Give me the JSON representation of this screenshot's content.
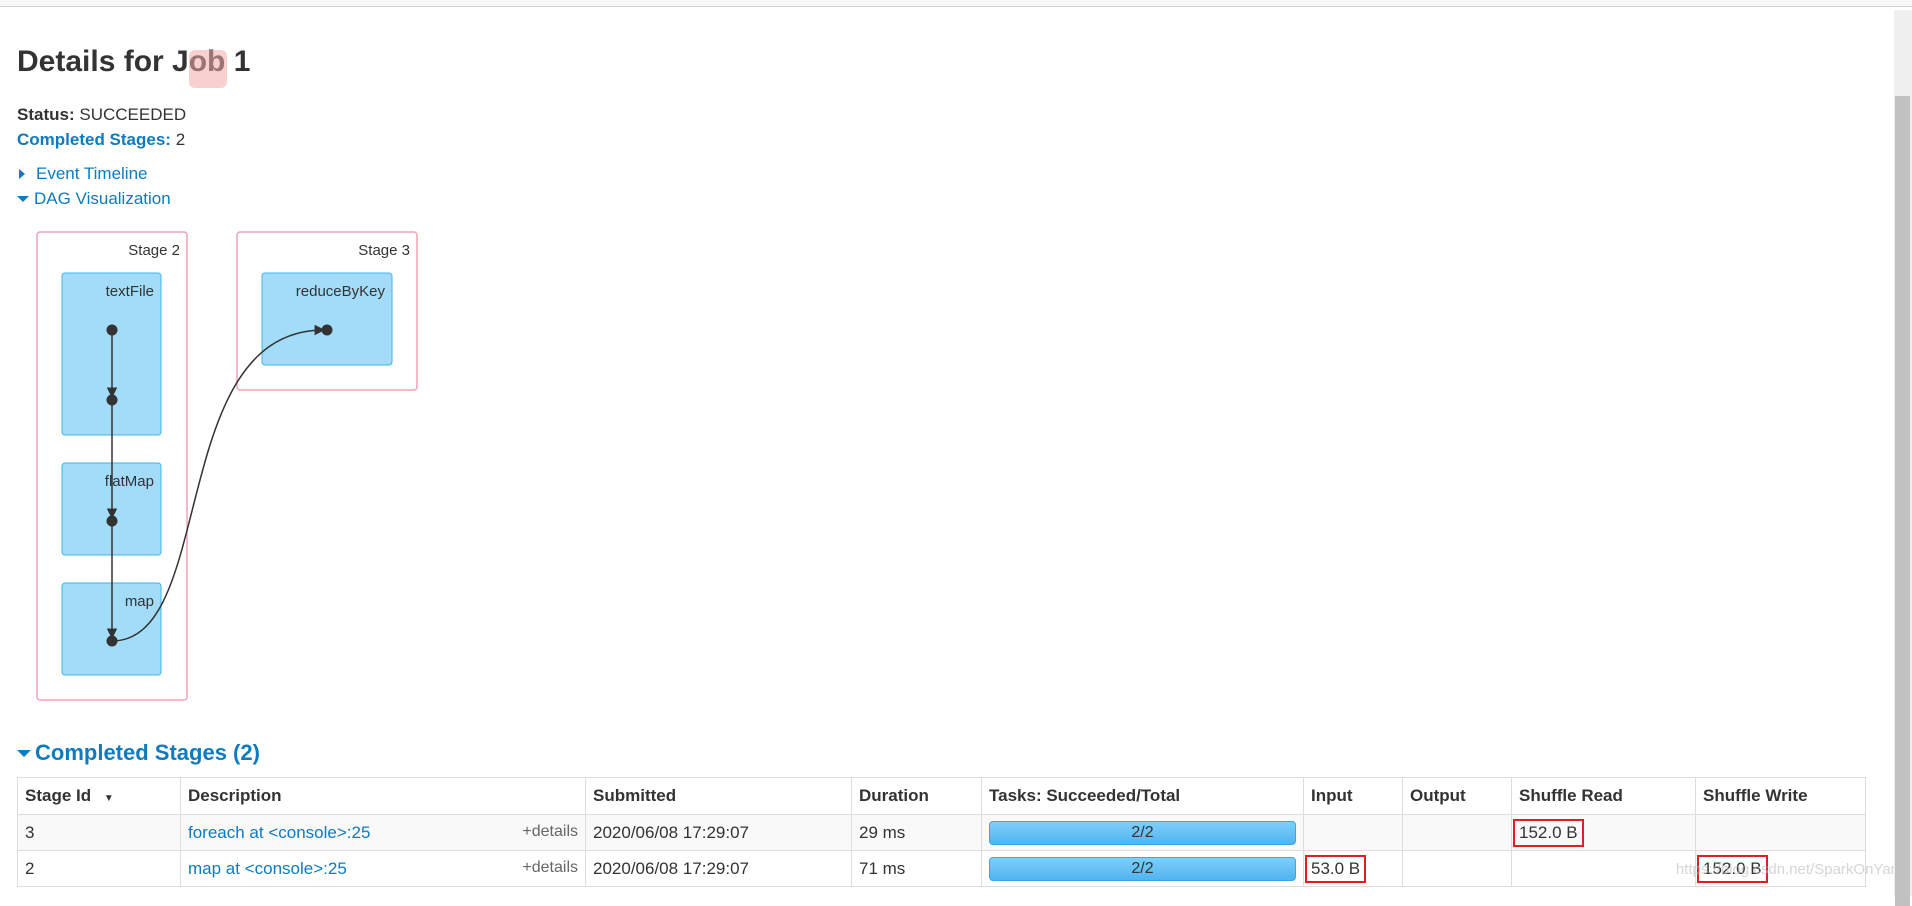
{
  "page": {
    "title": "Details for Job 1",
    "status_label": "Status:",
    "status_value": "SUCCEEDED",
    "completed_label": "Completed Stages:",
    "completed_value": "2",
    "event_timeline": "Event Timeline",
    "dag_visualization": "DAG Visualization"
  },
  "dag": {
    "stages": [
      {
        "label": "Stage 2",
        "ops": [
          "textFile",
          "flatMap",
          "map"
        ]
      },
      {
        "label": "Stage 3",
        "ops": [
          "reduceByKey"
        ]
      }
    ]
  },
  "stages_section": {
    "title": "Completed Stages (2)",
    "columns": [
      "Stage Id",
      "Description",
      "Submitted",
      "Duration",
      "Tasks: Succeeded/Total",
      "Input",
      "Output",
      "Shuffle Read",
      "Shuffle Write"
    ],
    "rows": [
      {
        "id": "3",
        "description": "foreach at <console>:25",
        "details": "+details",
        "submitted": "2020/06/08 17:29:07",
        "duration": "29 ms",
        "tasks": "2/2",
        "tasks_fraction": 1.0,
        "input": "",
        "output": "",
        "shuffle_read": "152.0 B",
        "shuffle_write": ""
      },
      {
        "id": "2",
        "description": "map at <console>:25",
        "details": "+details",
        "submitted": "2020/06/08 17:29:07",
        "duration": "71 ms",
        "tasks": "2/2",
        "tasks_fraction": 1.0,
        "input": "53.0 B",
        "output": "",
        "shuffle_read": "",
        "shuffle_write": "152.0 B"
      }
    ]
  },
  "watermark": "https://blog.csdn.net/SparkOnYarn",
  "colors": {
    "link": "#0d7bc0",
    "stage_border": "#f4a4b4",
    "op_fill": "#a3dcf8",
    "op_border": "#3fb6e8",
    "progress": "#5bbef5",
    "highlight": "#e02020"
  }
}
